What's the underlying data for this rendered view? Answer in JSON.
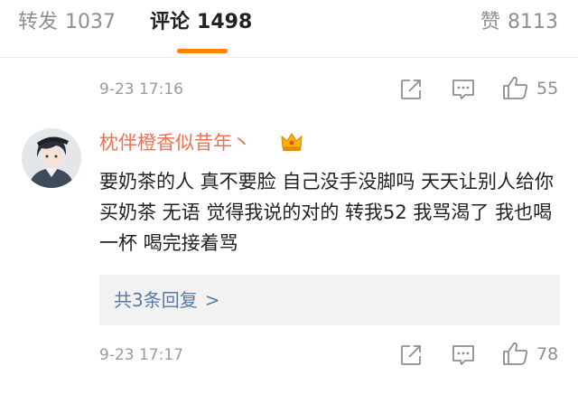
{
  "tabs": {
    "repost": {
      "label": "转发",
      "count": "1037"
    },
    "comments": {
      "label": "评论",
      "count": "1498"
    },
    "likes": {
      "label": "赞",
      "count": "8113"
    }
  },
  "comment_above": {
    "time": "9-23 17:16",
    "like_count": "55"
  },
  "comment": {
    "username": "枕伴橙香似昔年丶",
    "badge_icon": "crown-vip-icon",
    "text": "要奶茶的人 真不要脸 自己没手没脚吗 天天让别人给你买奶茶 无语 觉得我说的对的 转我52 我骂渴了 我也喝一杯 喝完接着骂",
    "replies_label": "共3条回复",
    "replies_arrow": ">",
    "time": "9-23 17:17",
    "like_count": "78"
  },
  "colors": {
    "accent": "#ff8200",
    "username": "#eb7350",
    "link": "#5a7aa6",
    "muted": "#8e8e8e"
  },
  "icons": [
    "share-icon",
    "comment-icon",
    "like-icon"
  ]
}
